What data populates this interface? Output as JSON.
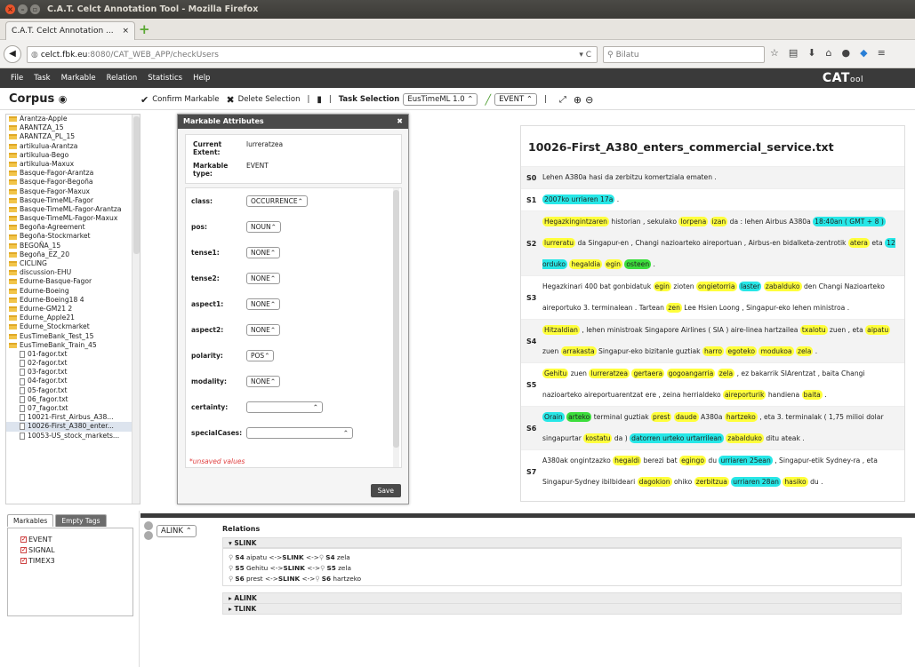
{
  "window": {
    "title": "C.A.T. Celct Annotation Tool - Mozilla Firefox"
  },
  "browser": {
    "tab_label": "C.A.T. Celct Annotation ...",
    "tab_close": "×",
    "new_tab": "+",
    "url_host": "celct.fbk.eu",
    "url_prefix": "",
    "url_rest": ":8080/CAT_WEB_APP/checkUsers",
    "search_placeholder": "Bilatu"
  },
  "menu": {
    "items": [
      "File",
      "Task",
      "Markable",
      "Relation",
      "Statistics",
      "Help"
    ],
    "logo": "CAT",
    "logo_suffix": "ool"
  },
  "toolbar": {
    "corpus": "Corpus",
    "confirm": "Confirm Markable",
    "delete": "Delete Selection",
    "task_label": "Task Selection",
    "task_value": "EusTimeML 1.0",
    "markable_value": "EVENT",
    "sep": "|"
  },
  "corpus": {
    "items": [
      {
        "t": "folder",
        "n": "Arantza-Apple"
      },
      {
        "t": "folder",
        "n": "ARANTZA_15"
      },
      {
        "t": "folder",
        "n": "ARANTZA_PL_15"
      },
      {
        "t": "folder",
        "n": "artikulua-Arantza"
      },
      {
        "t": "folder",
        "n": "artikulua-Bego"
      },
      {
        "t": "folder",
        "n": "artikulua-Maxux"
      },
      {
        "t": "folder",
        "n": "Basque-Fagor-Arantza"
      },
      {
        "t": "folder",
        "n": "Basque-Fagor-Begoña"
      },
      {
        "t": "folder",
        "n": "Basque-Fagor-Maxux"
      },
      {
        "t": "folder",
        "n": "Basque-TimeML-Fagor"
      },
      {
        "t": "folder",
        "n": "Basque-TimeML-Fagor-Arantza"
      },
      {
        "t": "folder",
        "n": "Basque-TimeML-Fagor-Maxux"
      },
      {
        "t": "folder",
        "n": "Begoña-Agreement"
      },
      {
        "t": "folder",
        "n": "Begoña-Stockmarket"
      },
      {
        "t": "folder",
        "n": "BEGOÑA_15"
      },
      {
        "t": "folder",
        "n": "Begoña_EZ_20"
      },
      {
        "t": "folder",
        "n": "CICLING"
      },
      {
        "t": "folder",
        "n": "discussion-EHU"
      },
      {
        "t": "folder",
        "n": "Edurne-Basque-Fagor"
      },
      {
        "t": "folder",
        "n": "Edurne-Boeing"
      },
      {
        "t": "folder",
        "n": "Edurne-Boeing18 4"
      },
      {
        "t": "folder",
        "n": "Edurne-GM21 2"
      },
      {
        "t": "folder",
        "n": "Edurne_Apple21"
      },
      {
        "t": "folder",
        "n": "Edurne_Stockmarket"
      },
      {
        "t": "folder",
        "n": "EusTimeBank_Test_15"
      },
      {
        "t": "folder",
        "n": "EusTimeBank_Train_45"
      },
      {
        "t": "file",
        "n": "01-fagor.txt"
      },
      {
        "t": "file",
        "n": "02-fagor.txt"
      },
      {
        "t": "file",
        "n": "03-fagor.txt"
      },
      {
        "t": "file",
        "n": "04-fagor.txt"
      },
      {
        "t": "file",
        "n": "05-fagor.txt"
      },
      {
        "t": "file",
        "n": "06_fagor.txt"
      },
      {
        "t": "file",
        "n": "07_fagor.txt"
      },
      {
        "t": "file",
        "n": "10021-First_Airbus_A38..."
      },
      {
        "t": "file",
        "n": "10026-First_A380_enter...",
        "sel": true
      },
      {
        "t": "file",
        "n": "10053-US_stock_markets..."
      }
    ]
  },
  "markables": {
    "tab_active": "Markables",
    "tab_inactive": "Empty Tags",
    "items": [
      "EVENT",
      "SIGNAL",
      "TIMEX3"
    ]
  },
  "dialog": {
    "title": "Markable Attributes",
    "close": "✖",
    "extent_label": "Current Extent:",
    "extent_value": "lurreratzea",
    "type_label": "Markable type:",
    "type_value": "EVENT",
    "attrs": [
      {
        "l": "class:",
        "v": "OCCURRENCE"
      },
      {
        "l": "pos:",
        "v": "NOUN"
      },
      {
        "l": "tense1:",
        "v": "NONE"
      },
      {
        "l": "tense2:",
        "v": "NONE"
      },
      {
        "l": "aspect1:",
        "v": "NONE"
      },
      {
        "l": "aspect2:",
        "v": "NONE"
      },
      {
        "l": "polarity:",
        "v": "POS"
      },
      {
        "l": "modality:",
        "v": "NONE"
      },
      {
        "l": "certainty:",
        "v": ""
      },
      {
        "l": "specialCases:",
        "v": ""
      }
    ],
    "unsaved": "*unsaved values",
    "save": "Save"
  },
  "document": {
    "title": "10026-First_A380_enters_commercial_service.txt",
    "sentences": [
      {
        "id": "S0",
        "html": "Lehen A380a hasi da zerbitzu komertziala ematen ."
      },
      {
        "id": "S1",
        "html": "<span class='c'>2007ko urriaren 17a</span> ."
      },
      {
        "id": "S2",
        "html": "<span class='y'>Hegazkingintzaren</span> historian , sekulako <span class='y'>lorpena</span> <span class='y'>izan</span> da : lehen Airbus A380a <span class='c'>18:40an ( GMT + 8 )</span> <span class='y'>lurreratu</span> da Singapur-en , Changi nazioarteko aireportuan , Airbus-en bidalketa-zentrotik <span class='y'>atera</span> eta <span class='c'>12 orduko</span> <span class='y'>hegaldia</span> <span class='y'>egin</span> <span class='g'>osteen</span> ."
      },
      {
        "id": "S3",
        "html": "Hegazkinari 400 bat gonbidatuk <span class='y'>egin</span> zioten <span class='y'>ongietorria</span> <span class='c'>laster</span> <span class='y'>zabalduko</span> den Changi Nazioarteko aireportuko 3. terminalean . Tartean <span class='y'>zen</span> Lee Hsien Loong , Singapur-eko lehen ministroa ."
      },
      {
        "id": "S4",
        "html": "<span class='y'>Hitzaldian</span> , lehen ministroak Singapore Airlines ( SIA ) aire-linea hartzailea <span class='y'>txalotu</span> zuen , eta <span class='y'>aipatu</span> zuen <span class='y'>arrakasta</span> Singapur-eko bizitanle guztiak <span class='y'>harro</span> <span class='y'>egoteko</span> <span class='y'>modukoa</span> <span class='y'>zela</span> ."
      },
      {
        "id": "S5",
        "html": "<span class='y'>Gehitu</span> zuen <span class='y'>lurreratzea</span> <span class='y'>gertaera</span> <span class='y'>gogoangarria</span> <span class='y'>zela</span> , ez bakarrik SIArentzat , baita Changi nazioarteko aireportuarentzat ere , zeina herrialdeko <span class='y'>aireporturik</span> handiena <span class='y'>baita</span> ."
      },
      {
        "id": "S6",
        "html": "<span class='c'>Orain</span> <span class='g'>arteko</span> terminal guztiak <span class='y'>prest</span> <span class='y'>daude</span> A380a <span class='y'>hartzeko</span> , eta 3. terminalak ( 1,75 milioi dolar singapurtar <span class='y'>kostatu</span> da ) <span class='c'>datorren urteko urtarrilean</span> <span class='y'>zabalduko</span> ditu ateak ."
      },
      {
        "id": "S7",
        "html": "A380ak ongintzazko <span class='y'>hegaldi</span> berezi bat <span class='y'>egingo</span> du <span class='c'>urriaren 25ean</span> , Singapur-etik Sydney-ra , eta Singapur-Sydney ibilbideari <span class='y'>dagokion</span> ohiko <span class='y'>zerbitzua</span> <span class='c'>urriaren 28an</span> <span class='y'>hasiko</span> du ."
      }
    ]
  },
  "relations": {
    "type_value": "ALINK",
    "title": "Relations",
    "slink": "SLINK",
    "alink": "ALINK",
    "tlink": "TLINK",
    "lines": [
      {
        "a": "S4",
        "aw": "aipatu",
        "r": "SLINK",
        "b": "S4",
        "bw": "zela"
      },
      {
        "a": "S5",
        "aw": "Gehitu",
        "r": "SLINK",
        "b": "S5",
        "bw": "zela"
      },
      {
        "a": "S6",
        "aw": "prest",
        "r": "SLINK",
        "b": "S6",
        "bw": "hartzeko"
      }
    ]
  }
}
